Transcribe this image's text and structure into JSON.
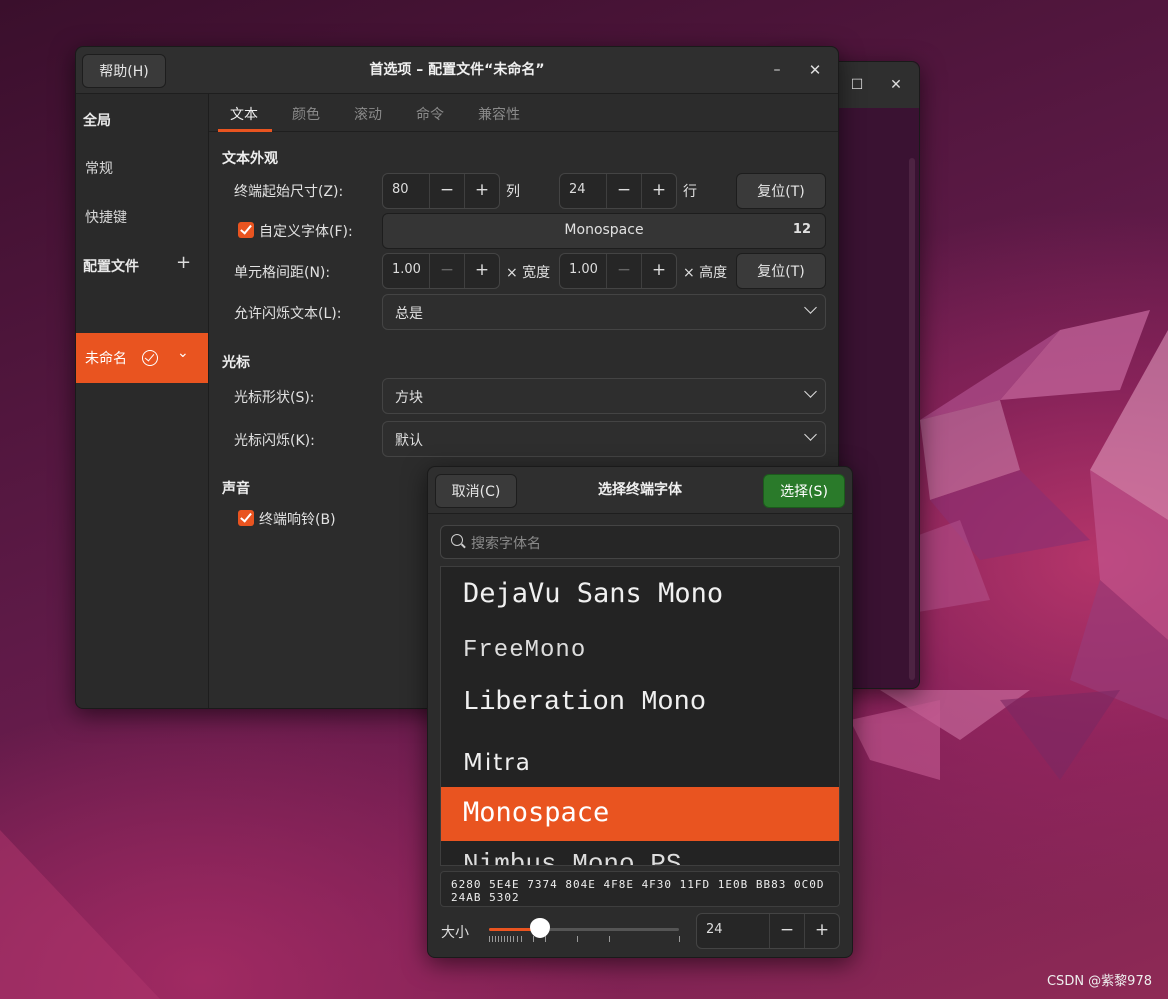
{
  "main_window": {
    "help_button": "帮助(H)",
    "title": "首选项 – 配置文件“未命名”",
    "minimize": "–",
    "close": "✕"
  },
  "bg_window": {
    "maximize": "☐",
    "close": "✕"
  },
  "sidebar": {
    "global_header": "全局",
    "general": "常规",
    "shortcuts": "快捷键",
    "profiles_header": "配置文件",
    "add_profile": "+",
    "active_profile": "未命名"
  },
  "tabs": [
    "文本",
    "颜色",
    "滚动",
    "命令",
    "兼容性"
  ],
  "text_tab": {
    "appearance_header": "文本外观",
    "initial_size_label": "终端起始尺寸(Z):",
    "columns_value": "80",
    "columns_unit": "列",
    "rows_value": "24",
    "rows_unit": "行",
    "reset_size": "复位(T)",
    "custom_font_label": "自定义字体(F):",
    "font_name": "Monospace",
    "font_size": "12",
    "cell_spacing_label": "单元格间距(N):",
    "width_spacing": "1.00",
    "width_unit": "× 宽度",
    "height_spacing": "1.00",
    "height_unit": "× 高度",
    "reset_spacing": "复位(T)",
    "blink_text_label": "允许闪烁文本(L):",
    "blink_text_value": "总是",
    "cursor_header": "光标",
    "cursor_shape_label": "光标形状(S):",
    "cursor_shape_value": "方块",
    "cursor_blink_label": "光标闪烁(K):",
    "cursor_blink_value": "默认",
    "sound_header": "声音",
    "bell_label": "终端响铃(B)",
    "minus": "−",
    "plus": "+"
  },
  "font_dialog": {
    "cancel": "取消(C)",
    "title": "选择终端字体",
    "select": "选择(S)",
    "search_placeholder": "搜索字体名",
    "fonts": [
      "DejaVu Sans Mono",
      "FreeMono",
      "Liberation Mono",
      "Mitra",
      "Monospace",
      "Nimbus Mono PS"
    ],
    "selected_font": "Monospace",
    "preview_text": "6280 5E4E 7374 804E 4F8E 4F30 11FD 1E0B BB83 0C0D 24AB 5302",
    "size_label": "大小",
    "size_value": "24",
    "size_slider_fraction": 0.27,
    "minus": "−",
    "plus": "+"
  },
  "watermark": "CSDN @紫黎978"
}
